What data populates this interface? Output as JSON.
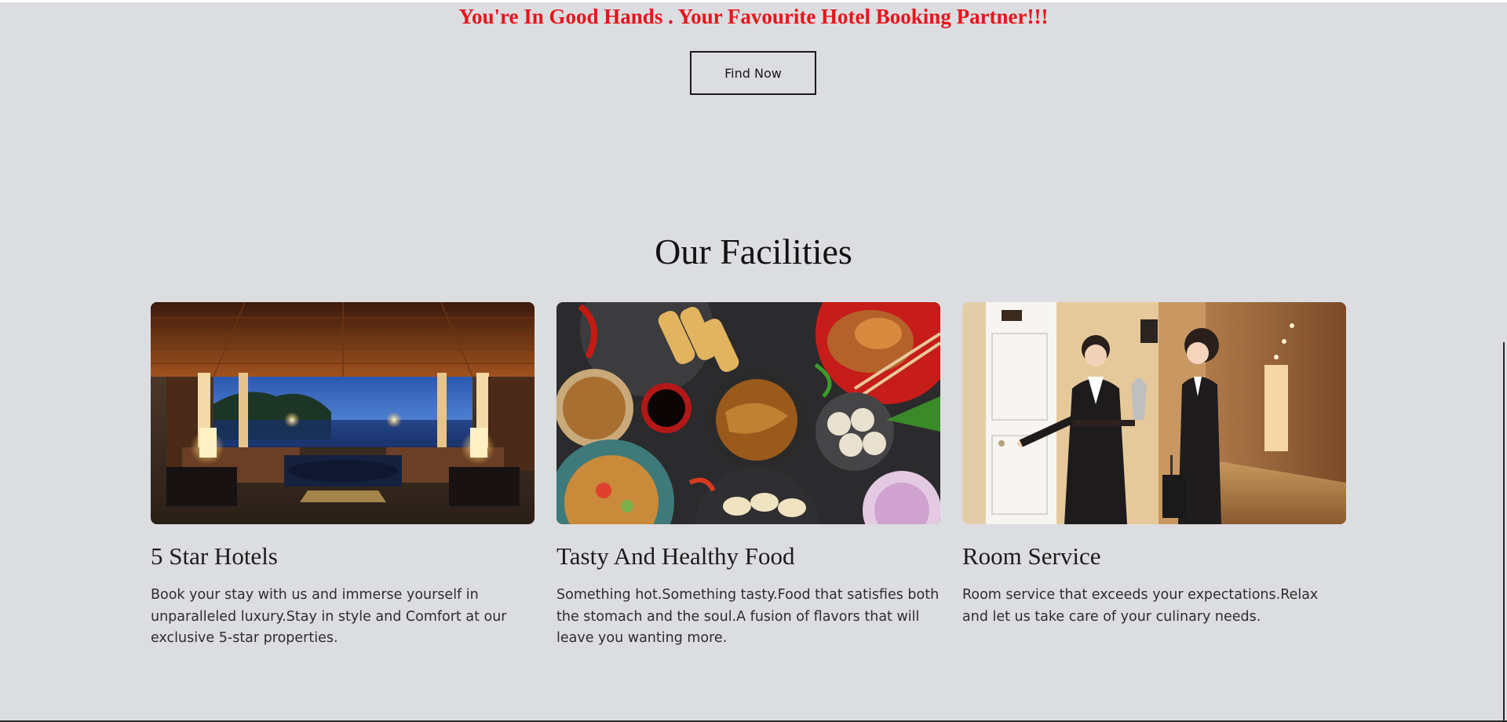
{
  "hero": {
    "tagline": "You're In Good Hands . Your Favourite Hotel Booking Partner!!!",
    "find_button_label": "Find Now"
  },
  "facilities": {
    "title": "Our Facilities",
    "cards": [
      {
        "title": "5 Star Hotels",
        "description": "Book your stay with us and immerse yourself in unparalleled luxury.Stay in style and Comfort at our exclusive 5-star properties."
      },
      {
        "title": "Tasty And Healthy Food",
        "description": "Something hot.Something tasty.Food that satisfies both the stomach and the soul.A fusion of flavors that will leave you wanting more."
      },
      {
        "title": "Room Service",
        "description": "Room service that exceeds your expectations.Relax and let us take care of your culinary needs."
      }
    ]
  },
  "colors": {
    "background": "#dcdde0",
    "tagline": "#e8141c",
    "text": "#222222"
  }
}
